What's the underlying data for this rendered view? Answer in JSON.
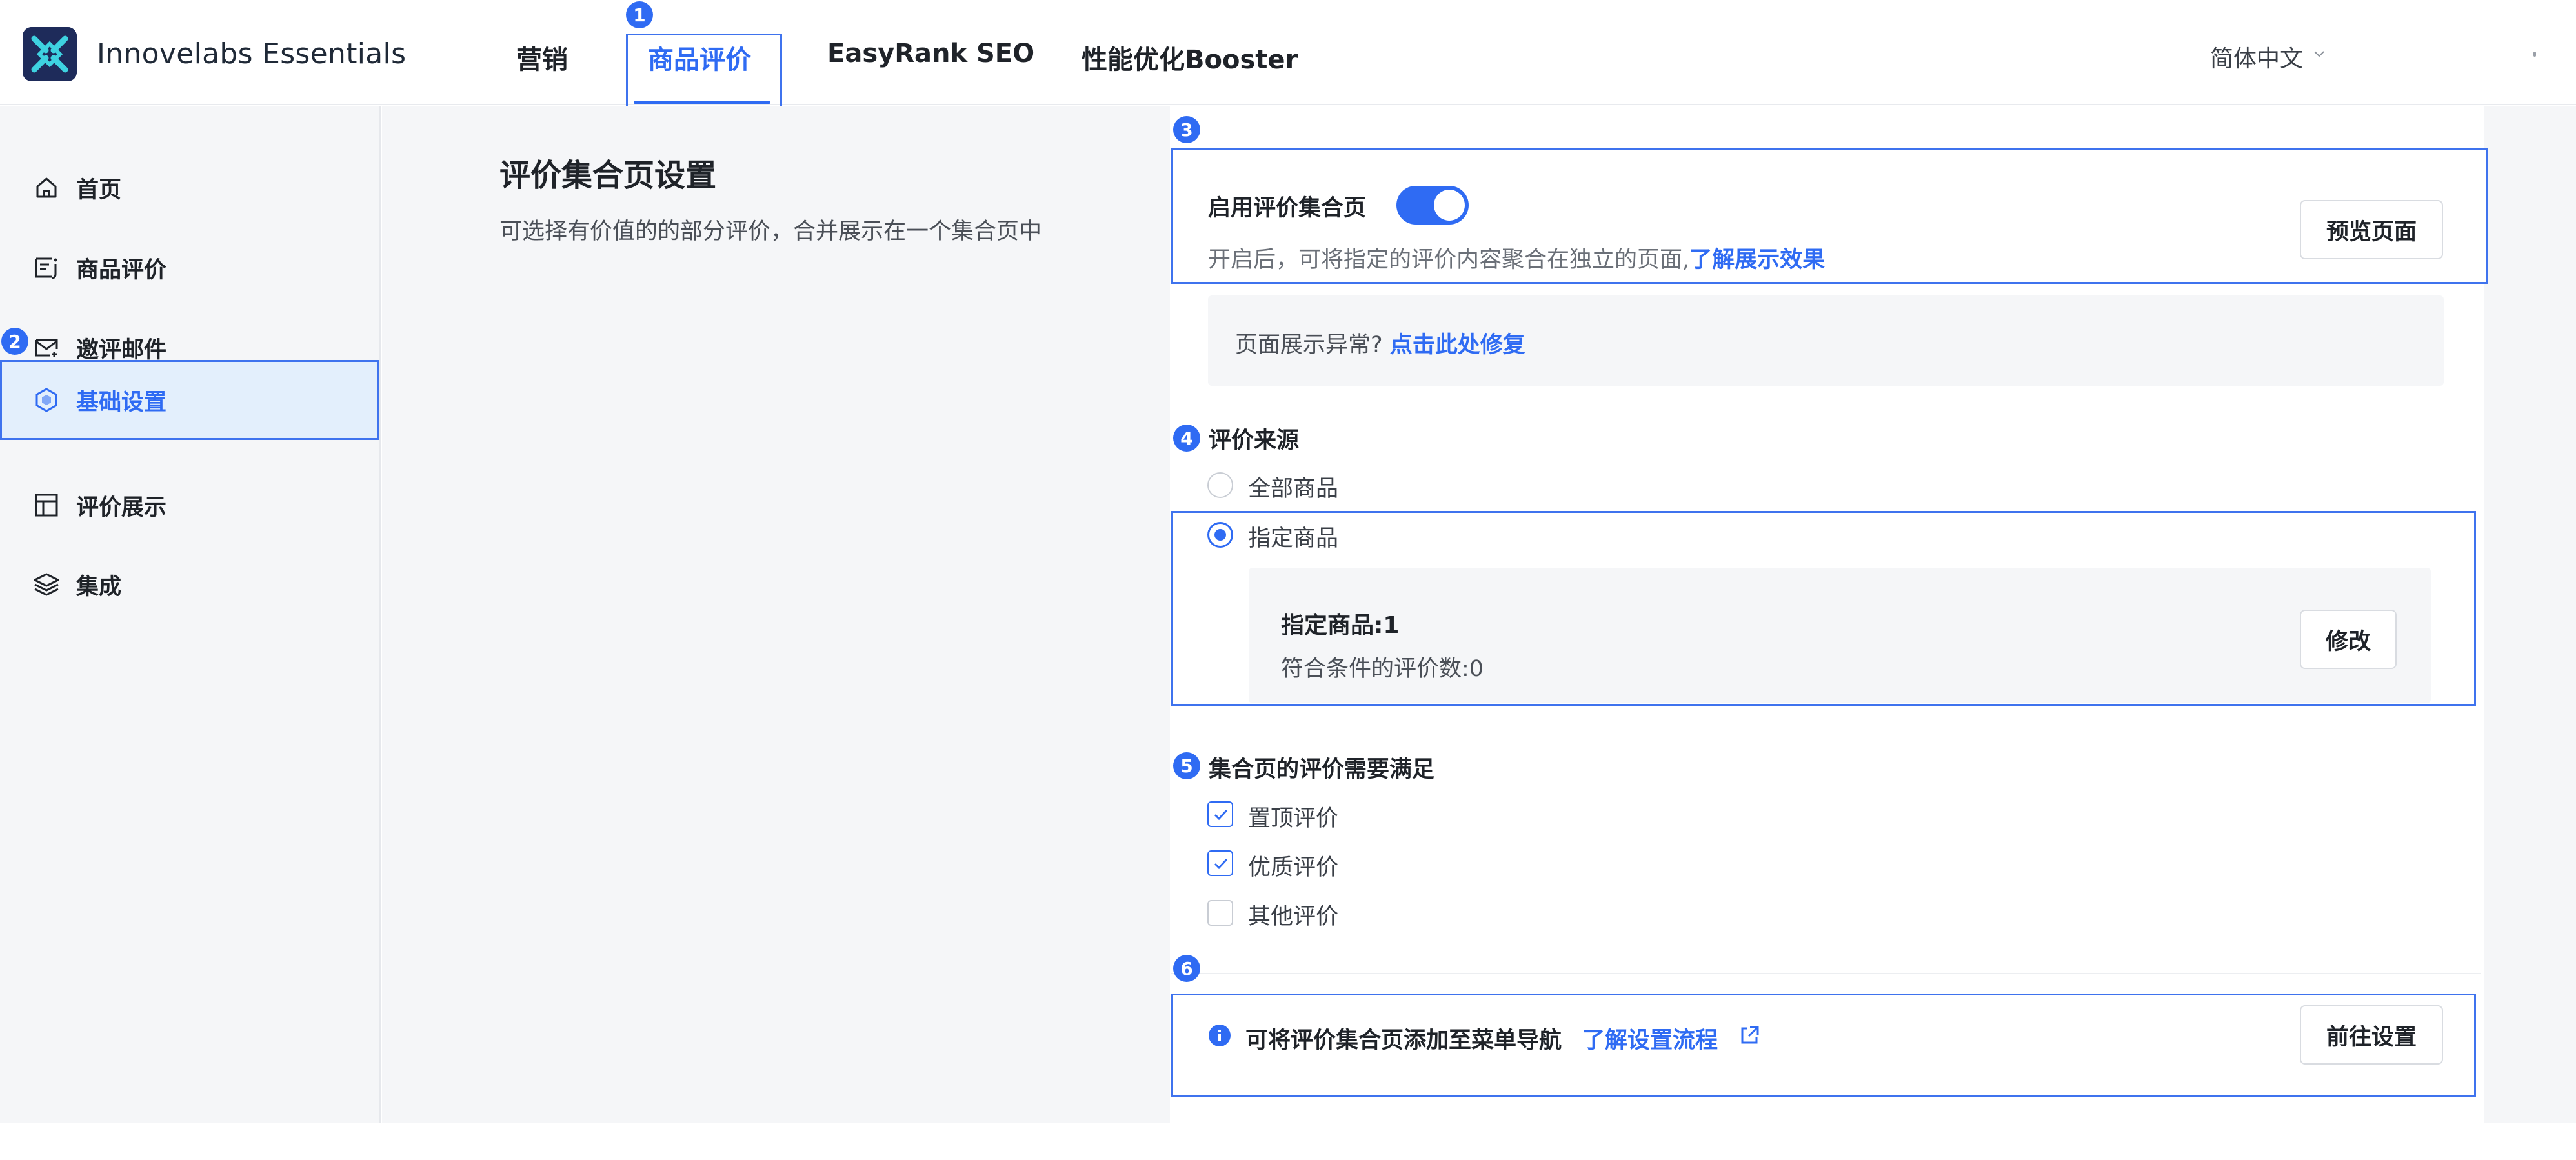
{
  "header": {
    "app_title": "Innovelabs Essentials",
    "nav": [
      {
        "label": "营销"
      },
      {
        "label": "商品评价"
      },
      {
        "label": "EasyRank SEO"
      },
      {
        "label": "性能优化Booster"
      }
    ],
    "language": "简体中文"
  },
  "annotations": [
    "1",
    "2",
    "3",
    "4",
    "5",
    "6"
  ],
  "sidebar": {
    "items": [
      {
        "label": "首页",
        "icon": "home-icon"
      },
      {
        "label": "商品评价",
        "icon": "review-list-icon"
      },
      {
        "label": "邀评邮件",
        "icon": "mail-icon"
      },
      {
        "label": "基础设置",
        "icon": "settings-hex-icon"
      },
      {
        "label": "评价展示",
        "icon": "layout-icon"
      },
      {
        "label": "集成",
        "icon": "layers-icon"
      }
    ]
  },
  "section": {
    "title": "评价集合页设置",
    "description": "可选择有价值的的部分评价，合并展示在一个集合页中"
  },
  "enable": {
    "label": "启用评价集合页",
    "toggle_on": true,
    "description": "开启后，可将指定的评价内容聚合在独立的页面,",
    "link": "了解展示效果",
    "preview_button": "预览页面"
  },
  "fix": {
    "text": "页面展示异常?",
    "link": "点击此处修复"
  },
  "source": {
    "title": "评价来源",
    "options": [
      {
        "label": "全部商品",
        "selected": false
      },
      {
        "label": "指定商品",
        "selected": true
      }
    ],
    "specified_count": "指定商品:1",
    "matching_reviews": "符合条件的评价数:0",
    "edit_button": "修改"
  },
  "criteria": {
    "title": "集合页的评价需要满足",
    "options": [
      {
        "label": "置顶评价",
        "checked": true
      },
      {
        "label": "优质评价",
        "checked": true
      },
      {
        "label": "其他评价",
        "checked": false
      }
    ]
  },
  "navigation": {
    "text": "可将评价集合页添加至菜单导航",
    "link": "了解设置流程",
    "button": "前往设置"
  },
  "colors": {
    "accent": "#2f6bf3",
    "annotation_border": "#3f73ee",
    "background": "#f5f6f8"
  }
}
